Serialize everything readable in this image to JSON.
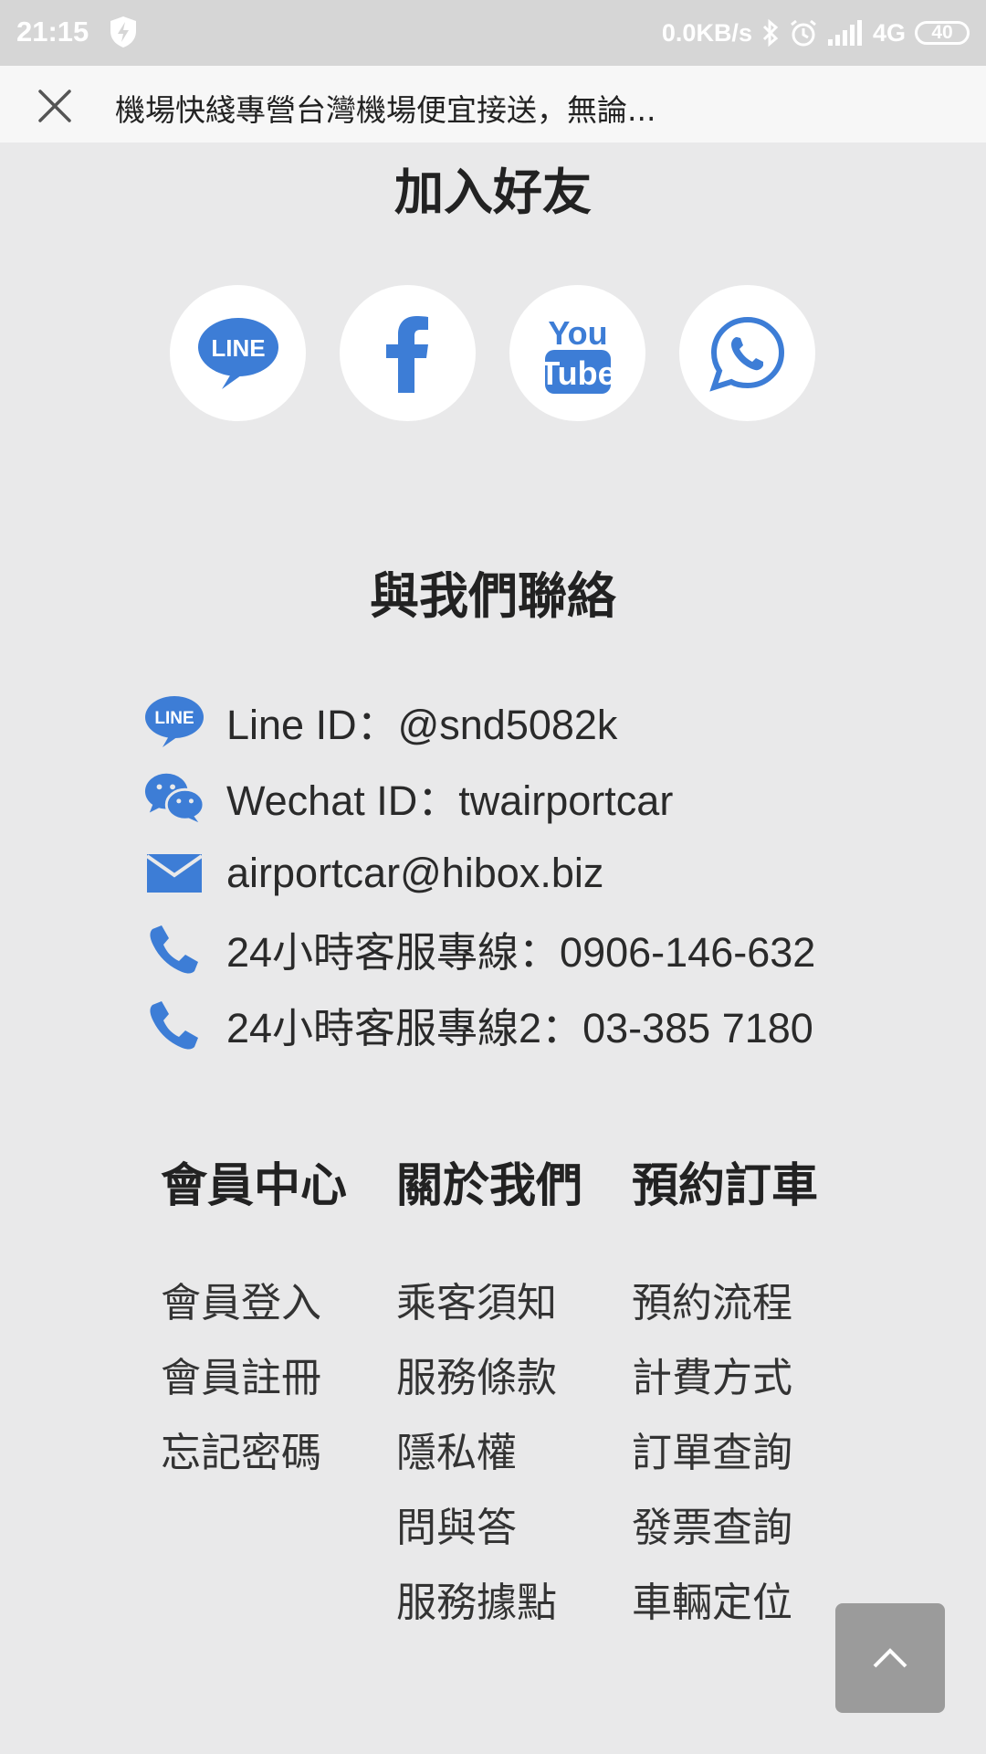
{
  "status_bar": {
    "time": "21:15",
    "net_speed": "0.0KB/s",
    "network": "4G",
    "battery": "40"
  },
  "title_bar": {
    "title": "機場快綫專營台灣機場便宜接送，無論..."
  },
  "join": {
    "heading": "加入好友",
    "brand_line_label": "LINE",
    "brand_youtube_top": "You",
    "brand_youtube_bottom": "Tube"
  },
  "contact": {
    "heading": "與我們聯絡",
    "items": [
      {
        "icon": "line-icon",
        "text": "Line ID：@snd5082k"
      },
      {
        "icon": "wechat-icon",
        "text": "Wechat ID：twairportcar"
      },
      {
        "icon": "mail-icon",
        "text": "airportcar@hibox.biz"
      },
      {
        "icon": "phone-icon",
        "text": "24小時客服專線：0906-146-632"
      },
      {
        "icon": "phone-icon",
        "text": "24小時客服專線2：03-385 7180"
      }
    ]
  },
  "footer": {
    "columns": [
      {
        "title": "會員中心",
        "links": [
          "會員登入",
          "會員註冊",
          "忘記密碼"
        ]
      },
      {
        "title": "關於我們",
        "links": [
          "乘客須知",
          "服務條款",
          "隱私權",
          "問與答",
          "服務據點"
        ]
      },
      {
        "title": "預約訂車",
        "links": [
          "預約流程",
          "計費方式",
          "訂單查詢",
          "發票查詢",
          "車輛定位"
        ]
      }
    ]
  },
  "colors": {
    "accent": "#3d7dd6",
    "background": "#e9e9ea",
    "status_bar": "#d6d6d6",
    "scroll_top_button": "#9b9b9b"
  }
}
